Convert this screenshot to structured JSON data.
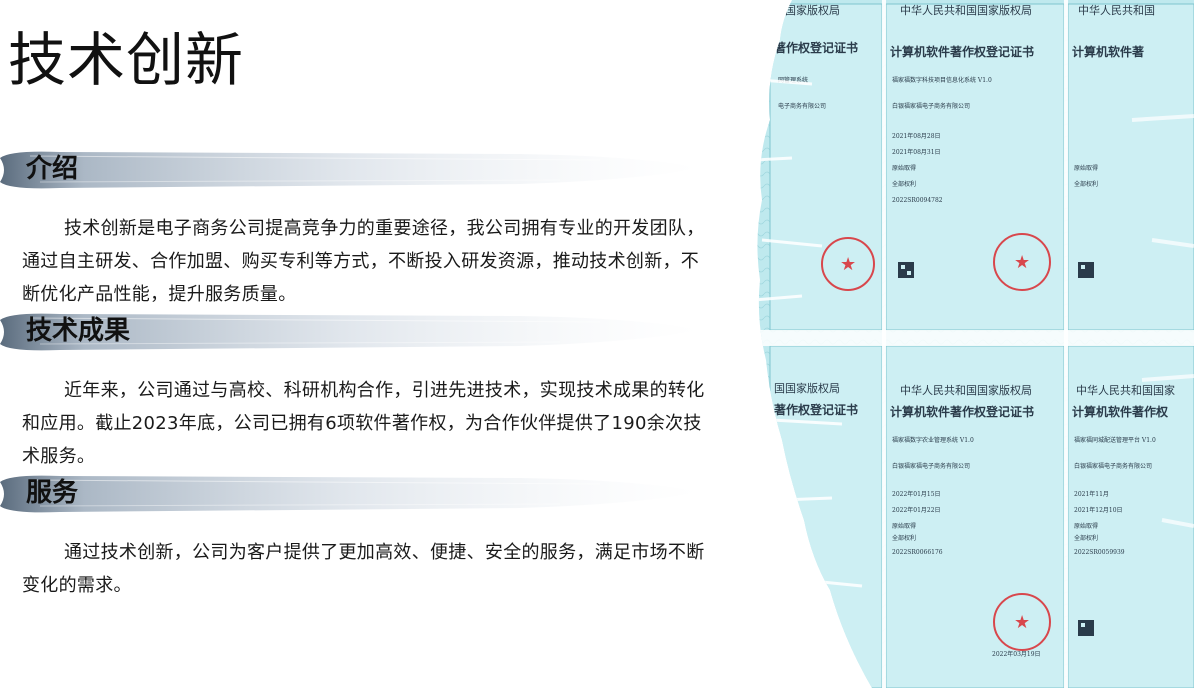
{
  "page": {
    "title": "技术创新"
  },
  "sections": [
    {
      "heading": "介绍",
      "body": "技术创新是电子商务公司提高竞争力的重要途径，我公司拥有专业的开发团队，通过自主研发、合作加盟、购买专利等方式，不断投入研发资源，推动技术创新，不断优化产品性能，提升服务质量。"
    },
    {
      "heading": "技术成果",
      "body": "近年来，公司通过与高校、科研机构合作，引进先进技术，实现技术成果的转化和应用。截止2023年底，公司已拥有6项软件著作权，为合作伙伴提供了190余次技术服务。"
    },
    {
      "heading": "服务",
      "body": "通过技术创新，公司为客户提供了更加高效、便捷、安全的服务，满足市场不断变化的需求。"
    }
  ],
  "certificates": {
    "top_row": [
      {
        "header": "国国家版权局",
        "title": "著作权登记证书",
        "software": "网管理系统",
        "owner": "电子商务有限公司"
      },
      {
        "header": "中华人民共和国国家版权局",
        "title": "计算机软件著作权登记证书",
        "software": "福家福数字科技项目信息化系统 V1.0",
        "owner": "白银福家福电子商务有限公司",
        "date1": "2021年08月28日",
        "date2": "2021年08月31日",
        "method": "原始取得",
        "scope": "全部权利",
        "number": "2022SR0094782"
      },
      {
        "header": "中华人民共和国",
        "title": "计算机软件著",
        "method": "原始取得",
        "scope": "全部权利"
      }
    ],
    "bottom_row": [
      {
        "header": "国国家版权局",
        "title": "著作权登记证书"
      },
      {
        "header": "中华人民共和国国家版权局",
        "title": "计算机软件著作权登记证书",
        "software": "福家福数字农业管理系统 V1.0",
        "owner": "白银福家福电子商务有限公司",
        "date1": "2022年01月15日",
        "date2": "2022年01月22日",
        "method": "原始取得",
        "scope": "全部权利",
        "number": "2022SR0066176",
        "stamp_date": "2022年03月19日"
      },
      {
        "header": "中华人民共和国国家",
        "title": "计算机软件著作权",
        "software": "福家福同城配送管理平台 V1.0",
        "owner": "白银福家福电子商务有限公司",
        "date1": "2021年11月",
        "date2": "2021年12月10日",
        "method": "原始取得",
        "scope": "全部权利",
        "number": "2022SR0059939"
      }
    ]
  },
  "colors": {
    "banner_dark": "#3d5166",
    "banner_light": "#c9d3de",
    "cert_bg": "#bfe9ee",
    "cert_seal": "#d8474c"
  }
}
